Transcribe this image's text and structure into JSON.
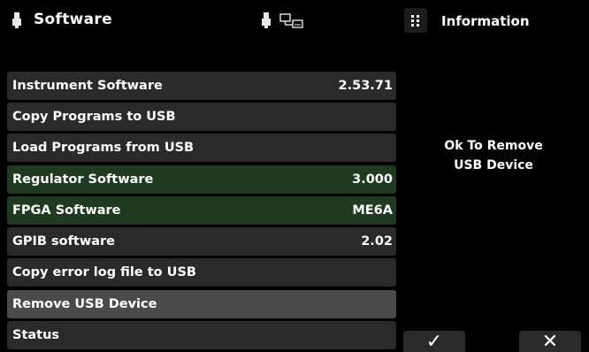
{
  "header": {
    "title": "Software",
    "left_icon": "usb-icon",
    "status_icons": [
      "usb-icon",
      "network-icon"
    ]
  },
  "info_panel": {
    "menu_icon": "grid-menu-icon",
    "title": "Information",
    "message_line1": "Ok To Remove",
    "message_line2": "USB Device"
  },
  "menu": {
    "items": [
      {
        "label": "Instrument Software",
        "value": "2.53.71",
        "style": "normal"
      },
      {
        "label": "Copy Programs to USB",
        "value": "",
        "style": "normal"
      },
      {
        "label": "Load Programs from USB",
        "value": "",
        "style": "normal"
      },
      {
        "label": "Regulator Software",
        "value": "3.000",
        "style": "green"
      },
      {
        "label": "FPGA Software",
        "value": "ME6A",
        "style": "green"
      },
      {
        "label": "GPIB software",
        "value": "2.02",
        "style": "normal"
      },
      {
        "label": "Copy error log file to USB",
        "value": "",
        "style": "normal"
      },
      {
        "label": "Remove USB Device",
        "value": "",
        "style": "selected"
      },
      {
        "label": "Status",
        "value": "",
        "style": "normal"
      }
    ]
  },
  "buttons": {
    "confirm_glyph": "✓",
    "cancel_glyph": "✕"
  },
  "colors": {
    "background": "#000000",
    "item_normal": "#2a2a2a",
    "item_green": "#1f3b1f",
    "item_selected": "#4a4a4a"
  }
}
